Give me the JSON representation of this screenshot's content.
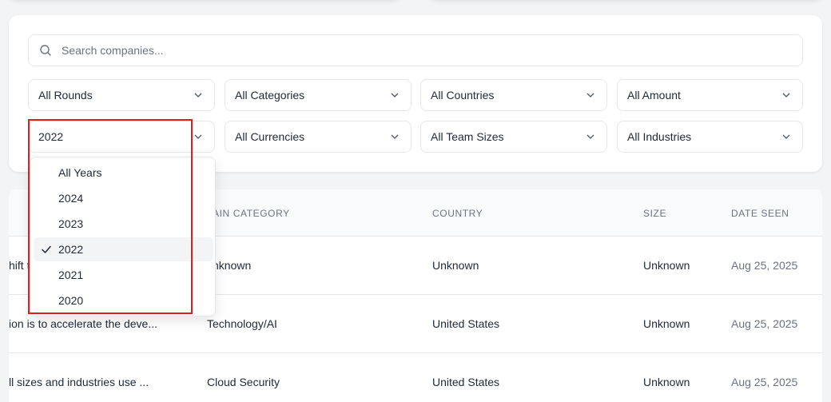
{
  "search": {
    "placeholder": "Search companies..."
  },
  "filters": {
    "rounds": "All Rounds",
    "categories": "All Categories",
    "countries": "All Countries",
    "amount": "All Amount",
    "year": "2022",
    "currencies": "All Currencies",
    "team_sizes": "All Team Sizes",
    "industries": "All Industries"
  },
  "year_dropdown": {
    "options": [
      "All Years",
      "2024",
      "2023",
      "2022",
      "2021",
      "2020"
    ],
    "selected": "2022"
  },
  "table": {
    "headers": {
      "category": "AIN CATEGORY",
      "country": "COUNTRY",
      "size": "SIZE",
      "date": "DATE SEEN"
    },
    "rows": [
      {
        "desc": "hift t",
        "category": "nknown",
        "country": "Unknown",
        "size": "Unknown",
        "date": "Aug 25, 2025"
      },
      {
        "desc": "ion is to accelerate the deve...",
        "category": "Technology/AI",
        "country": "United States",
        "size": "Unknown",
        "date": "Aug 25, 2025"
      },
      {
        "desc": "ll sizes and industries use ...",
        "category": "Cloud Security",
        "country": "United States",
        "size": "Unknown",
        "date": "Aug 25, 2025"
      }
    ]
  },
  "colors": {
    "highlight": "#e11d1d",
    "muted_text": "#6b7280",
    "border": "#e5e7eb"
  }
}
